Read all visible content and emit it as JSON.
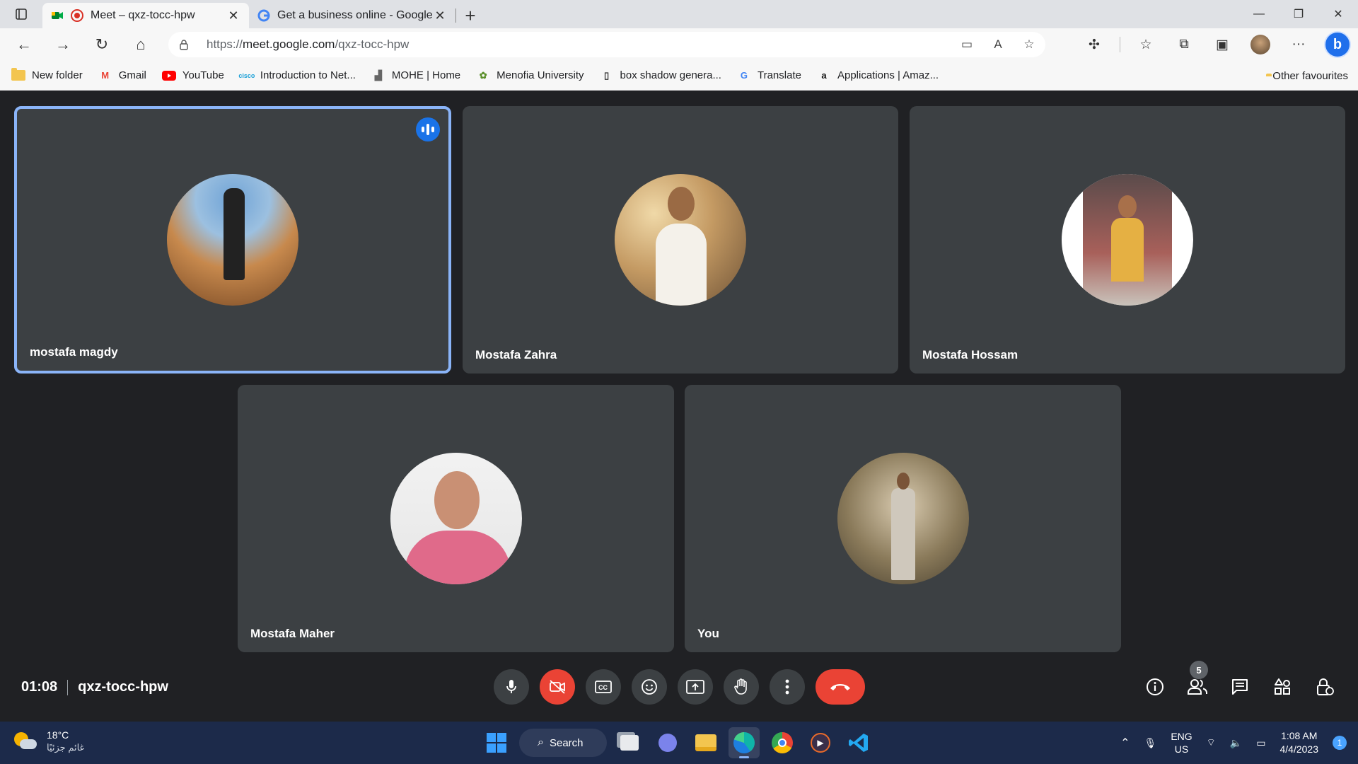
{
  "browser": {
    "tabs": [
      {
        "title": "Meet – qxz-tocc-hpw",
        "active": true
      },
      {
        "title": "Get a business online - Google D",
        "active": false
      }
    ],
    "new_tab_label": "+",
    "address": {
      "prefix": "https://",
      "host": "meet.google.com",
      "path": "/qxz-tocc-hpw"
    },
    "bookmarks": [
      {
        "label": "New folder",
        "icon": "folder-icon"
      },
      {
        "label": "Gmail",
        "icon": "gmail-icon"
      },
      {
        "label": "YouTube",
        "icon": "youtube-icon"
      },
      {
        "label": "Introduction to Net...",
        "icon": "cisco-icon"
      },
      {
        "label": "MOHE | Home",
        "icon": "mohe-icon"
      },
      {
        "label": "Menofia University",
        "icon": "menofia-icon"
      },
      {
        "label": "box shadow genera...",
        "icon": "page-icon"
      },
      {
        "label": "Translate",
        "icon": "translate-icon"
      },
      {
        "label": "Applications | Amaz...",
        "icon": "amazon-icon"
      }
    ],
    "other_favourites": "Other favourites"
  },
  "meet": {
    "participants": [
      {
        "name": "mostafa magdy",
        "speaking": true,
        "bg": "#b97a45"
      },
      {
        "name": "Mostafa Zahra",
        "speaking": false,
        "bg": "#d8b48a"
      },
      {
        "name": "Mostafa Hossam",
        "speaking": false,
        "bg": "#e5b043"
      },
      {
        "name": "Mostafa Maher",
        "speaking": false,
        "bg": "#e06a8a"
      },
      {
        "name": "You",
        "speaking": false,
        "bg": "#8a7a5a"
      }
    ],
    "time": "01:08",
    "code": "qxz-tocc-hpw",
    "participant_count": "5",
    "accent": "#8ab4f8",
    "danger": "#ea4335"
  },
  "taskbar": {
    "temperature": "18°C",
    "condition": "غائم جزئيًا",
    "search_label": "Search",
    "lang_line1": "ENG",
    "lang_line2": "US",
    "time": "1:08 AM",
    "date": "4/4/2023",
    "notification_count": "1"
  }
}
